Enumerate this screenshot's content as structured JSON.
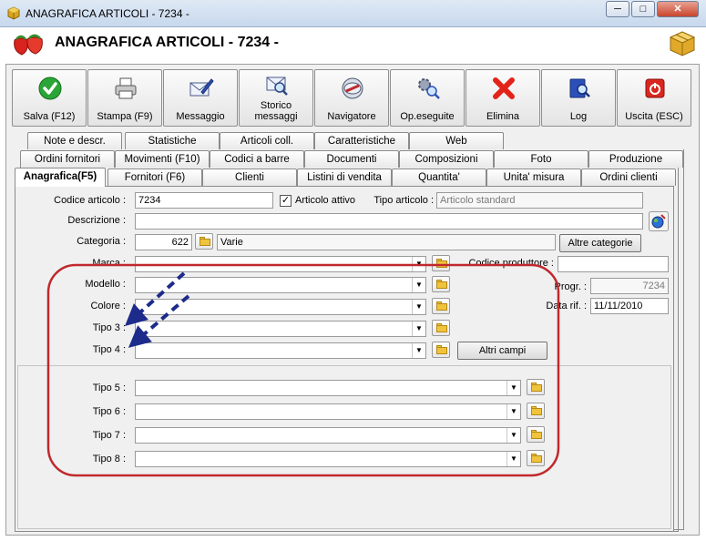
{
  "window": {
    "title": "ANAGRAFICA ARTICOLI - 7234 -",
    "header_title": "ANAGRAFICA ARTICOLI - 7234 -",
    "minimize_label": "─",
    "maximize_label": "□",
    "close_label": "✕"
  },
  "toolbar": [
    {
      "label": "Salva (F12)",
      "icon": "check-icon"
    },
    {
      "label": "Stampa (F9)",
      "icon": "printer-icon"
    },
    {
      "label": "Messaggio",
      "icon": "envelope-pen-icon"
    },
    {
      "label": "Storico messaggi",
      "icon": "envelope-search-icon"
    },
    {
      "label": "Navigatore",
      "icon": "compass-icon"
    },
    {
      "label": "Op.eseguite",
      "icon": "gears-search-icon"
    },
    {
      "label": "Elimina",
      "icon": "delete-x-icon"
    },
    {
      "label": "Log",
      "icon": "book-search-icon"
    },
    {
      "label": "Uscita (ESC)",
      "icon": "power-icon"
    }
  ],
  "tabs": {
    "row1": [
      "Note e descr.",
      "Statistiche",
      "Articoli coll.",
      "Caratteristiche",
      "Web"
    ],
    "row2": [
      "Ordini fornitori",
      "Movimenti (F10)",
      "Codici a barre",
      "Documenti",
      "Composizioni",
      "Foto",
      "Produzione"
    ],
    "row3": [
      "Anagrafica(F5)",
      "Fornitori (F6)",
      "Clienti",
      "Listini di vendita",
      "Quantita'",
      "Unita' misura",
      "Ordini clienti"
    ]
  },
  "form": {
    "codice_label": "Codice articolo :",
    "codice_value": "7234",
    "attivo_label": "Articolo attivo",
    "attivo_check": "✓",
    "tipo_articolo_label": "Tipo articolo :",
    "tipo_articolo_value": "Articolo standard",
    "descrizione_label": "Descrizione :",
    "descrizione_value": "",
    "categoria_label": "Categoria :",
    "categoria_code": "622",
    "categoria_value": "Varie",
    "altre_categorie": "Altre categorie",
    "marca_label": "Marca :",
    "codice_produttore_label": "Codice produttore :",
    "modello_label": "Modello :",
    "progr_label": "Progr. :",
    "progr_value": "7234",
    "colore_label": "Colore :",
    "data_rif_label": "Data rif. :",
    "data_rif_value": "11/11/2010",
    "tipo3_label": "Tipo 3 :",
    "tipo4_label": "Tipo 4 :",
    "altri_campi": "Altri campi",
    "tipo5_label": "Tipo 5 :",
    "tipo6_label": "Tipo 6 :",
    "tipo7_label": "Tipo 7 :",
    "tipo8_label": "Tipo 8 :",
    "dropdown_arrow": "▼"
  },
  "colors": {
    "annotation_red": "#c0282d",
    "annotation_arrow": "#1d2b8a",
    "check_green": "#2aa536",
    "delete_red": "#e3231a"
  }
}
